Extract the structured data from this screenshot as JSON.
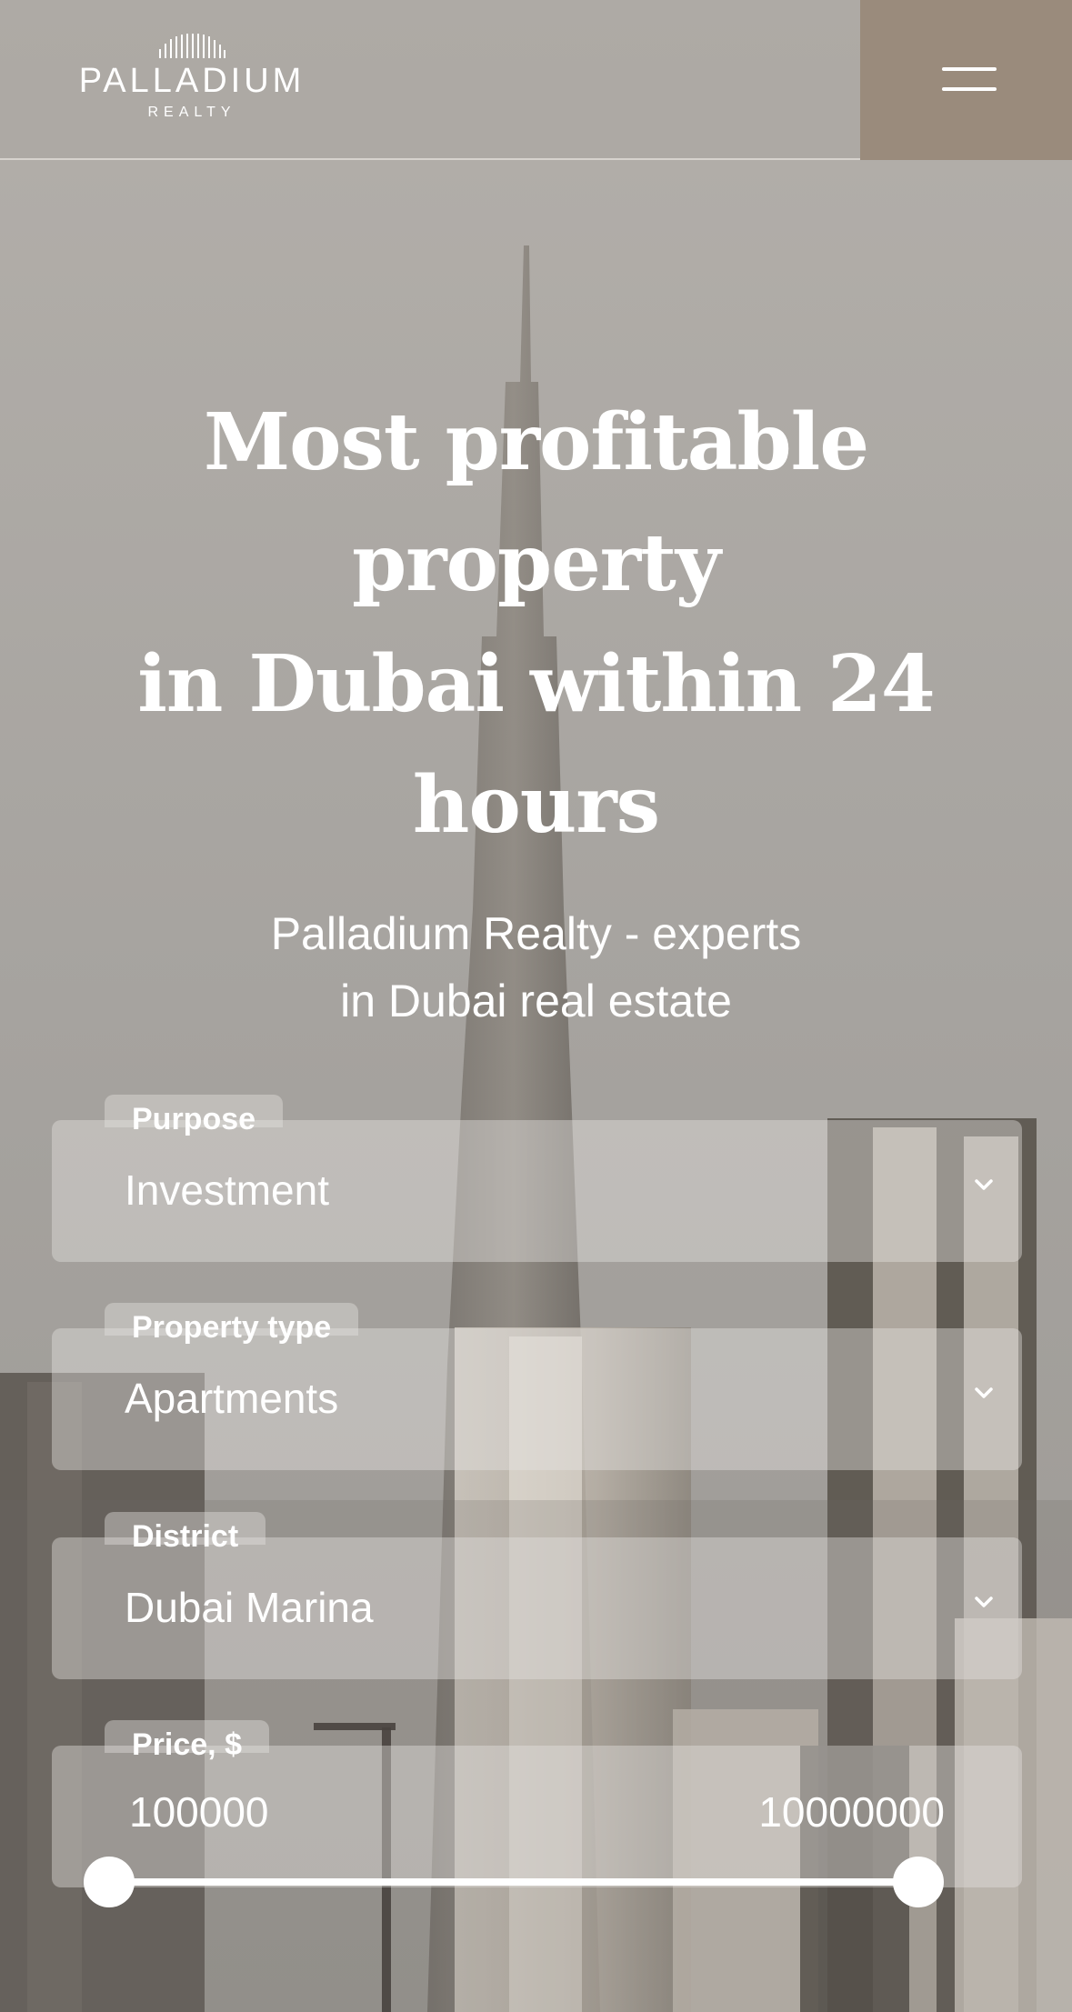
{
  "header": {
    "logo_text": "PALLADIUM",
    "logo_subtext": "REALTY",
    "menu_icon": "hamburger-icon"
  },
  "hero": {
    "title_lines": [
      "Most profitable",
      "property",
      "in Dubai within 24",
      "hours"
    ],
    "subtitle_lines": [
      "Palladium Realty - experts",
      "in Dubai real estate"
    ]
  },
  "form": {
    "purpose": {
      "label": "Purpose",
      "value": "Investment",
      "icon": "chevron-down-icon"
    },
    "property_type": {
      "label": "Property type",
      "value": "Apartments",
      "icon": "chevron-down-icon"
    },
    "district": {
      "label": "District",
      "value": "Dubai Marina",
      "icon": "chevron-down-icon"
    },
    "price": {
      "label": "Price, $",
      "min": "100000",
      "max": "10000000",
      "selected_min_fraction": 0,
      "selected_max_fraction": 1
    }
  },
  "colors": {
    "menu_button_bg": "#9a8b7c",
    "text": "#ffffff"
  }
}
